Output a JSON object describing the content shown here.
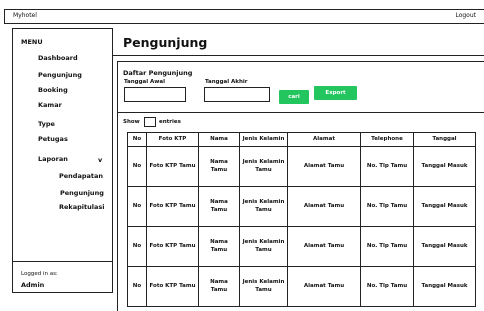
{
  "app": {
    "title": "Myhotel",
    "logout_label": "Logout"
  },
  "sidebar": {
    "menu_title": "MENU",
    "items": [
      {
        "label": "Dashboard"
      },
      {
        "label": "Pengunjung"
      },
      {
        "label": "Booking"
      },
      {
        "label": "Kamar"
      },
      {
        "label": "Type"
      },
      {
        "label": "Petugas"
      },
      {
        "label": "Laporan",
        "chevron": "v"
      },
      {
        "label": "Pendapatan"
      },
      {
        "label": "Pengunjung"
      },
      {
        "label": "Rekapitulasi"
      }
    ],
    "logged_in_label": "Logged in as:",
    "user": "Admin"
  },
  "page": {
    "title": "Pengunjung"
  },
  "filter": {
    "section_title": "Daftar Pengunjung",
    "start_label": "Tanggal Awal",
    "end_label": "Tanggal Akhir",
    "search_button": "cari",
    "export_button": "Export",
    "button_color": "#22c55e"
  },
  "table": {
    "show_label": "Show",
    "entries_label": "entries",
    "headers": [
      "No",
      "Foto KTP",
      "Nama",
      "Jenis Kelamin",
      "Alamat",
      "Telephone",
      "Tanggal"
    ],
    "rows": [
      [
        "No",
        "Foto KTP Tamu",
        "Nama Tamu",
        "Jenis Kelamin Tamu",
        "Alamat Tamu",
        "No. Tlp Tamu",
        "Tanggal Masuk"
      ],
      [
        "No",
        "Foto KTP Tamu",
        "Nama Tamu",
        "Jenis Kelamin Tamu",
        "Alamat Tamu",
        "No. Tlp Tamu",
        "Tanggal Masuk"
      ],
      [
        "No",
        "Foto KTP Tamu",
        "Nama Tamu",
        "Jenis Kelamin Tamu",
        "Alamat Tamu",
        "No. Tlp Tamu",
        "Tanggal Masuk"
      ],
      [
        "No",
        "Foto KTP Tamu",
        "Nama Tamu",
        "Jenis Kelamin Tamu",
        "Alamat Tamu",
        "No. Tlp Tamu",
        "Tanggal Masuk"
      ]
    ]
  }
}
